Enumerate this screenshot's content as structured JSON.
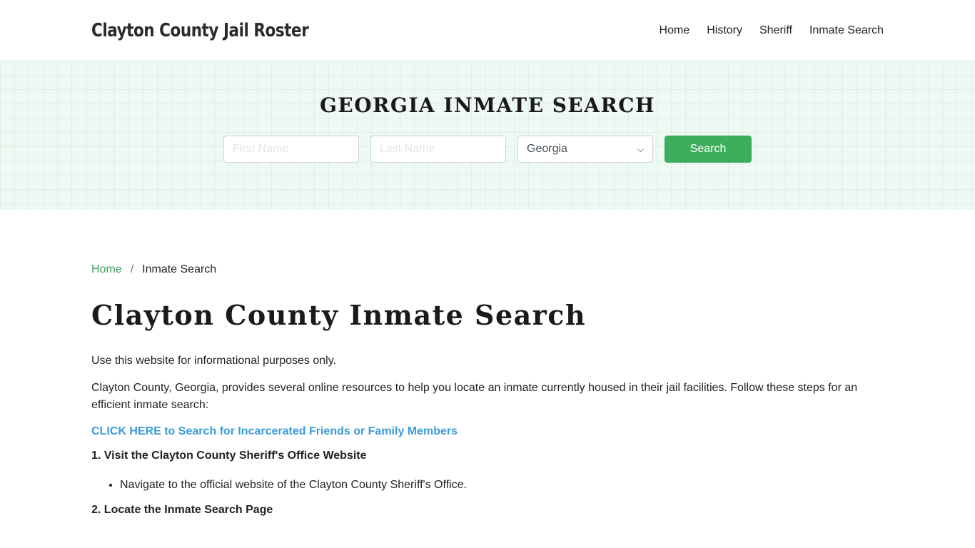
{
  "header": {
    "brand": "Clayton County Jail Roster",
    "nav": [
      {
        "label": "Home"
      },
      {
        "label": "History"
      },
      {
        "label": "Sheriff"
      },
      {
        "label": "Inmate Search"
      }
    ]
  },
  "hero": {
    "title": "GEORGIA INMATE SEARCH",
    "first_name_placeholder": "First Name",
    "first_name_value": "",
    "last_name_placeholder": "Last Name",
    "last_name_value": "",
    "state_selected": "Georgia",
    "search_label": "Search",
    "accent_color": "#3cae5c"
  },
  "breadcrumb": {
    "home": "Home",
    "separator": "/",
    "current": "Inmate Search"
  },
  "content": {
    "title": "Clayton County Inmate Search",
    "intro": "Use this website for informational purposes only.",
    "paragraph": "Clayton County, Georgia, provides several online resources to help you locate an inmate currently housed in their jail facilities. Follow these steps for an efficient inmate search:",
    "cta": "CLICK HERE to Search for Incarcerated Friends or Family Members",
    "step1_title": "1. Visit the Clayton County Sheriff's Office Website",
    "step1_items": [
      "Navigate to the official website of the Clayton County Sheriff's Office."
    ],
    "step2_title": "2. Locate the Inmate Search Page"
  }
}
